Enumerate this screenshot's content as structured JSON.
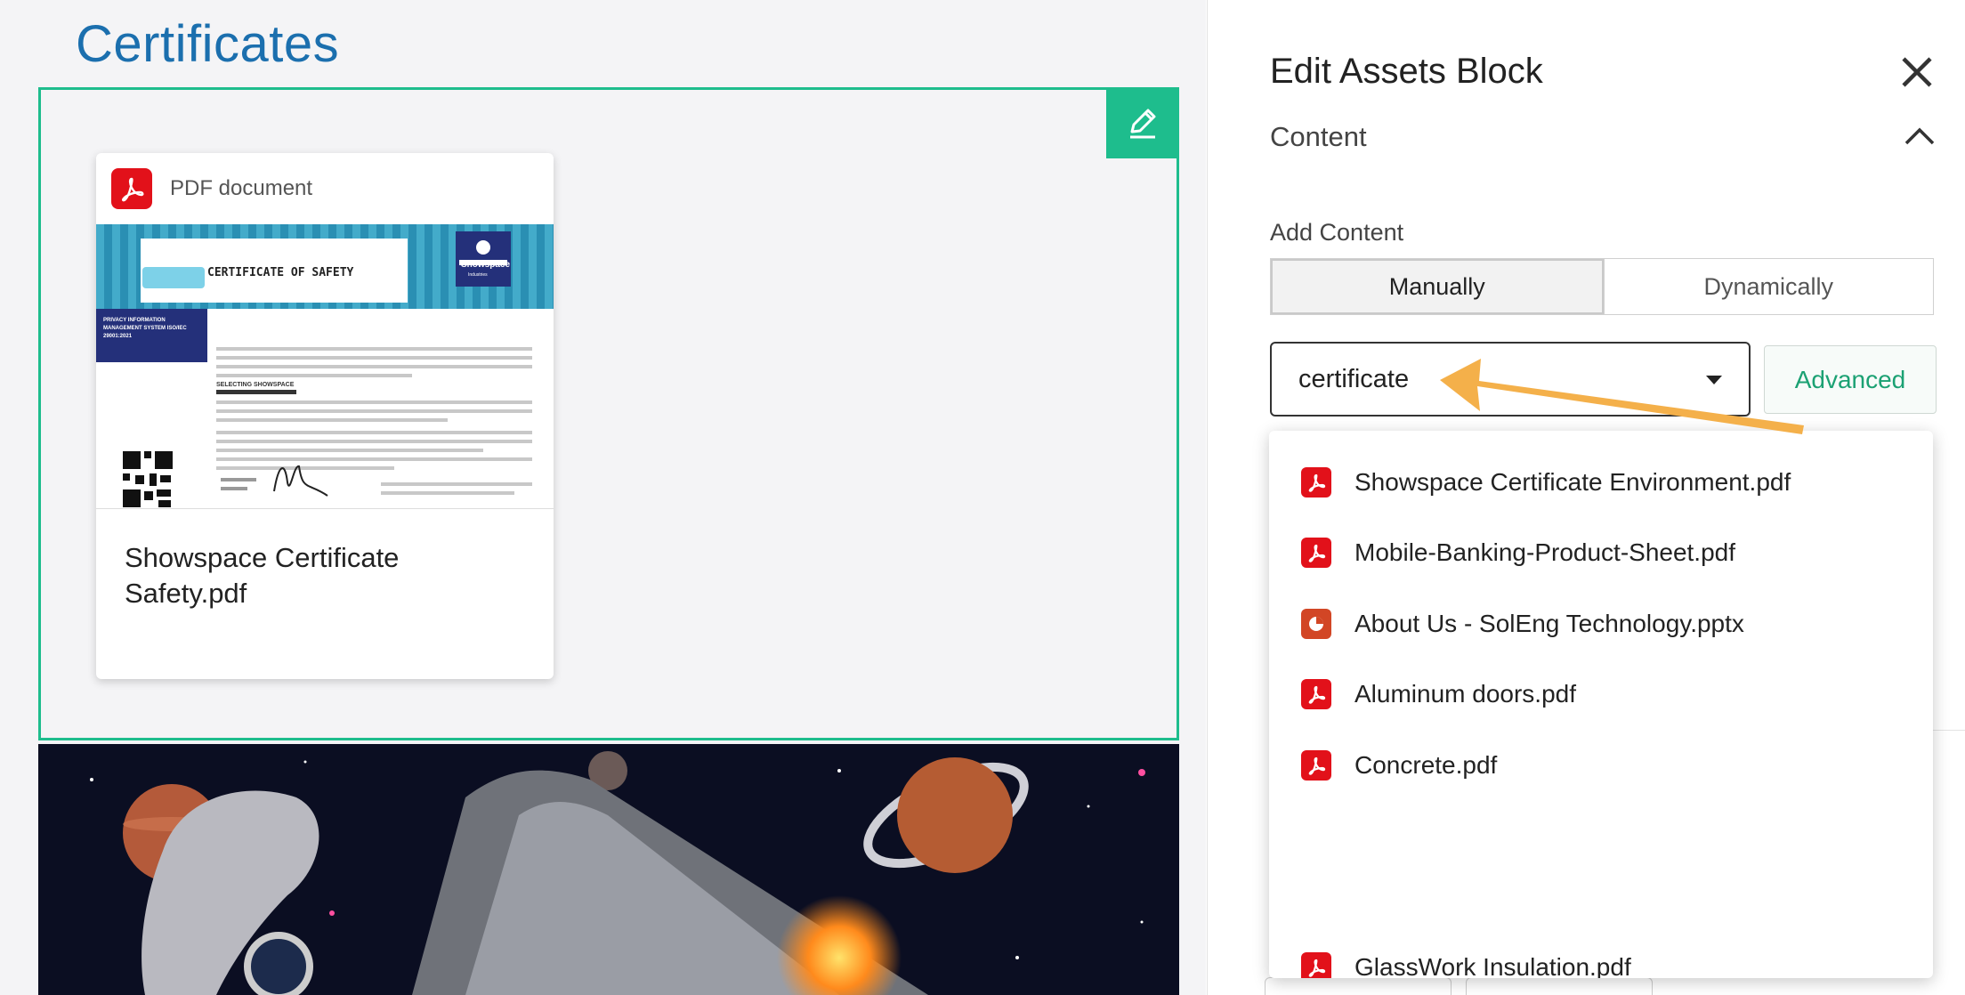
{
  "canvas": {
    "page_title": "Certificates",
    "card": {
      "type_label": "PDF document",
      "title": "Showspace Certificate Safety.pdf",
      "thumbnail": {
        "heading": "CERTIFICATE OF SAFETY",
        "brand": "Showspace",
        "brand_sub": "Industries",
        "side_label": "PRIVACY INFORMATION MANAGEMENT SYSTEM ISO/IEC 29001:2021",
        "section": "SELECTING SHOWSPACE"
      }
    }
  },
  "panel": {
    "title": "Edit Assets Block",
    "section_label": "Content",
    "add_content_label": "Add Content",
    "mode_tabs": [
      {
        "label": "Manually",
        "selected": true
      },
      {
        "label": "Dynamically",
        "selected": false
      }
    ],
    "search": {
      "value": "certificate"
    },
    "advanced_label": "Advanced",
    "dropdown_items": [
      {
        "label": "Showspace Certificate Environment.pdf",
        "icon": "pdf-icon"
      },
      {
        "label": "Mobile-Banking-Product-Sheet.pdf",
        "icon": "pdf-icon"
      },
      {
        "label": "About Us - SolEng Technology.pptx",
        "icon": "pptx-icon"
      },
      {
        "label": "Aluminum doors.pdf",
        "icon": "pdf-icon"
      },
      {
        "label": "Concrete.pdf",
        "icon": "pdf-icon"
      },
      {
        "label": "GlassWork Insulation.pdf",
        "icon": "pdf-icon"
      }
    ]
  },
  "colors": {
    "accent_green": "#1ebd8d",
    "title_blue": "#1b6fae",
    "pdf_red": "#e2111a",
    "pptx_orange": "#d24625",
    "arrow_orange": "#f4b04a"
  }
}
